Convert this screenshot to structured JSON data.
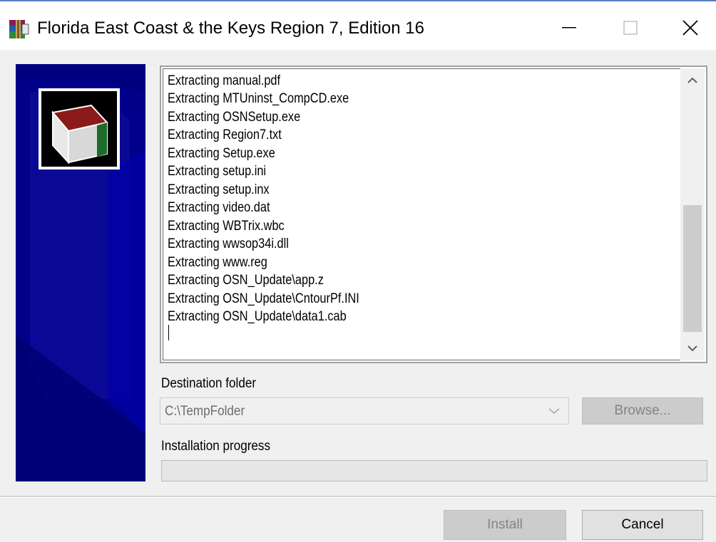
{
  "window": {
    "title": "Florida East Coast & the Keys Region 7, Edition 16"
  },
  "log": {
    "lines": [
      "Extracting manual.pdf",
      "Extracting MTUninst_CompCD.exe",
      "Extracting OSNSetup.exe",
      "Extracting Region7.txt",
      "Extracting Setup.exe",
      "Extracting setup.ini",
      "Extracting setup.inx",
      "Extracting video.dat",
      "Extracting WBTrix.wbc",
      "Extracting wwsop34i.dll",
      "Extracting www.reg",
      "Extracting OSN_Update\\app.z",
      "Extracting OSN_Update\\CntourPf.INI",
      "Extracting OSN_Update\\data1.cab"
    ]
  },
  "destination": {
    "label": "Destination folder",
    "value": "C:\\TempFolder",
    "browse_label": "Browse..."
  },
  "progress": {
    "label": "Installation progress",
    "fraction": 0
  },
  "buttons": {
    "install_label": "Install",
    "cancel_label": "Cancel"
  },
  "colors": {
    "side_panel": "#00007f",
    "title_accent": "#5a7ec6"
  }
}
